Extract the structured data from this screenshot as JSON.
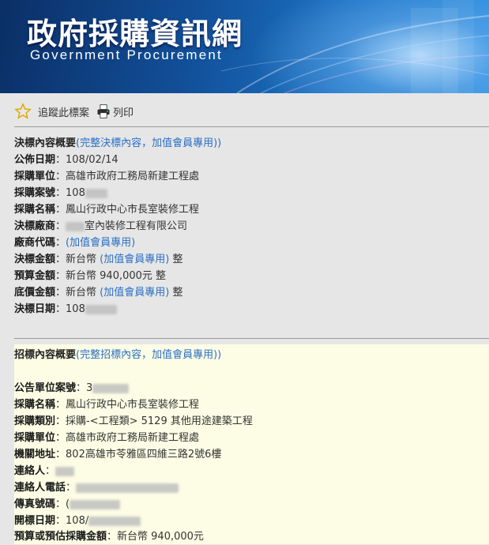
{
  "banner": {
    "title": "政府採購資訊網",
    "subtitle": "Government Procurement"
  },
  "toolbar": {
    "track_label": "追蹤此標案",
    "print_label": "列印"
  },
  "award": {
    "section_title": "決標內容概要",
    "section_link_open": "(",
    "section_link_full": "(完整決標內容，加值會員專用)",
    "section_link_close": ")",
    "fields": [
      {
        "label": "公佈日期",
        "value": "108/02/14"
      },
      {
        "label": "採購單位",
        "value": "高雄市政府工務局新建工程處"
      },
      {
        "label": "採購案號",
        "value": "108"
      },
      {
        "label": "採購名稱",
        "value": "鳳山行政中心市長室裝修工程"
      },
      {
        "label": "決標廠商",
        "value": "室內裝修工程有限公司"
      },
      {
        "label": "廠商代碼",
        "value": "(加值會員專用)"
      },
      {
        "label": "決標金額",
        "value_prefix": "新台幣 ",
        "link": "(加值會員專用)",
        "value_suffix": " 整"
      },
      {
        "label": "預算金額",
        "value": "新台幣 940,000元 整"
      },
      {
        "label": "底價金額",
        "value_prefix": "新台幣 ",
        "link": "(加值會員專用)",
        "value_suffix": " 整"
      },
      {
        "label": "決標日期",
        "value": "108"
      }
    ]
  },
  "tender": {
    "section_title": "招標內容概要",
    "section_link_full": "(完整招標內容，加值會員專用)",
    "fields": [
      {
        "label": "公告單位案號",
        "value": "3"
      },
      {
        "label": "採購名稱",
        "value": "鳳山行政中心市長室裝修工程"
      },
      {
        "label": "採購類別",
        "value": "採購-<工程類> 5129 其他用途建築工程"
      },
      {
        "label": "採購單位",
        "value": "高雄市政府工務局新建工程處"
      },
      {
        "label": "機關地址",
        "value": "802高雄市苓雅區四維三路2號6樓"
      },
      {
        "label": "連絡人",
        "value": ""
      },
      {
        "label": "連絡人電話",
        "value": ""
      },
      {
        "label": "傳真號碼",
        "value": "("
      },
      {
        "label": "開標日期",
        "value": "108/"
      },
      {
        "label": "預算或預估採購金額",
        "value": "新台幣 940,000元"
      }
    ]
  },
  "colors": {
    "link": "#2a6fc4",
    "background": "#e6e6e6",
    "tender_panel": "#fdfde6"
  }
}
